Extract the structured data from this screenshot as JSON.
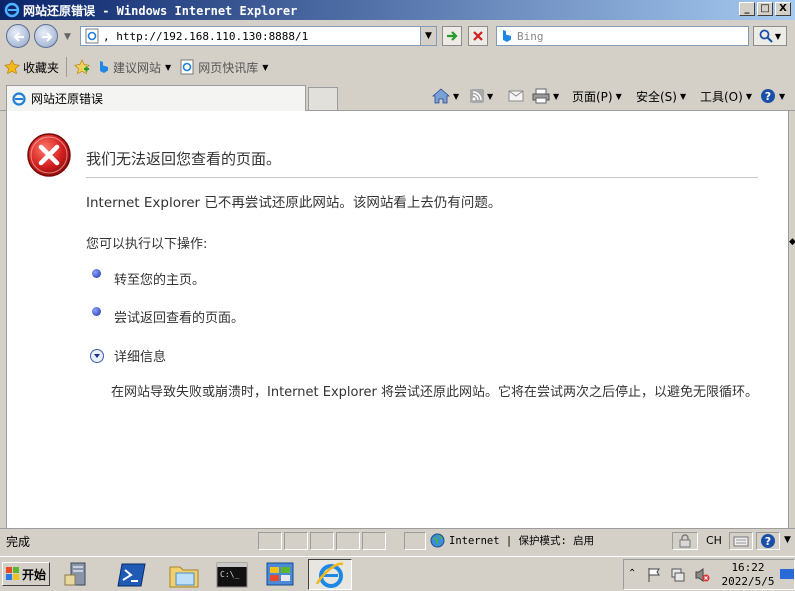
{
  "window": {
    "title": "网站还原错误 - Windows Internet Explorer",
    "minimize_glyph": "_",
    "maximize_glyph": "□",
    "close_glyph": "X"
  },
  "address_bar": {
    "url": ", http://192.168.110.130:8888/1",
    "search_placeholder": "Bing"
  },
  "favorites_bar": {
    "favorites_label": "收藏夹",
    "items": [
      {
        "label": "建议网站",
        "icon": "bing-icon"
      },
      {
        "label": "网页快讯库",
        "icon": "webslice-icon"
      }
    ]
  },
  "tabs": [
    {
      "label": "网站还原错误",
      "active": true
    }
  ],
  "command_bar": {
    "page_label": "页面(P)",
    "safety_label": "安全(S)",
    "tools_label": "工具(O)"
  },
  "page": {
    "heading": "我们无法返回您查看的页面。",
    "message": "Internet Explorer 已不再尝试还原此网站。该网站看上去仍有问题。",
    "actions_intro": "您可以执行以下操作:",
    "actions": [
      "转至您的主页。",
      "尝试返回查看的页面。"
    ],
    "more_info_label": "详细信息",
    "more_info_text": "在网站导致失败或崩溃时，Internet Explorer 将尝试还原此网站。它将在尝试两次之后停止，以避免无限循环。"
  },
  "status_bar": {
    "status": "完成",
    "zone": "Internet | 保护模式: 启用",
    "language": "CH"
  },
  "taskbar": {
    "start_label": "开始",
    "time": "16:22",
    "date": "2022/5/5"
  },
  "colors": {
    "title_gradient_start": "#0a246a",
    "title_gradient_end": "#a6caf0",
    "error_red": "#c8161d",
    "link_bullet": "#1a2fa8"
  }
}
